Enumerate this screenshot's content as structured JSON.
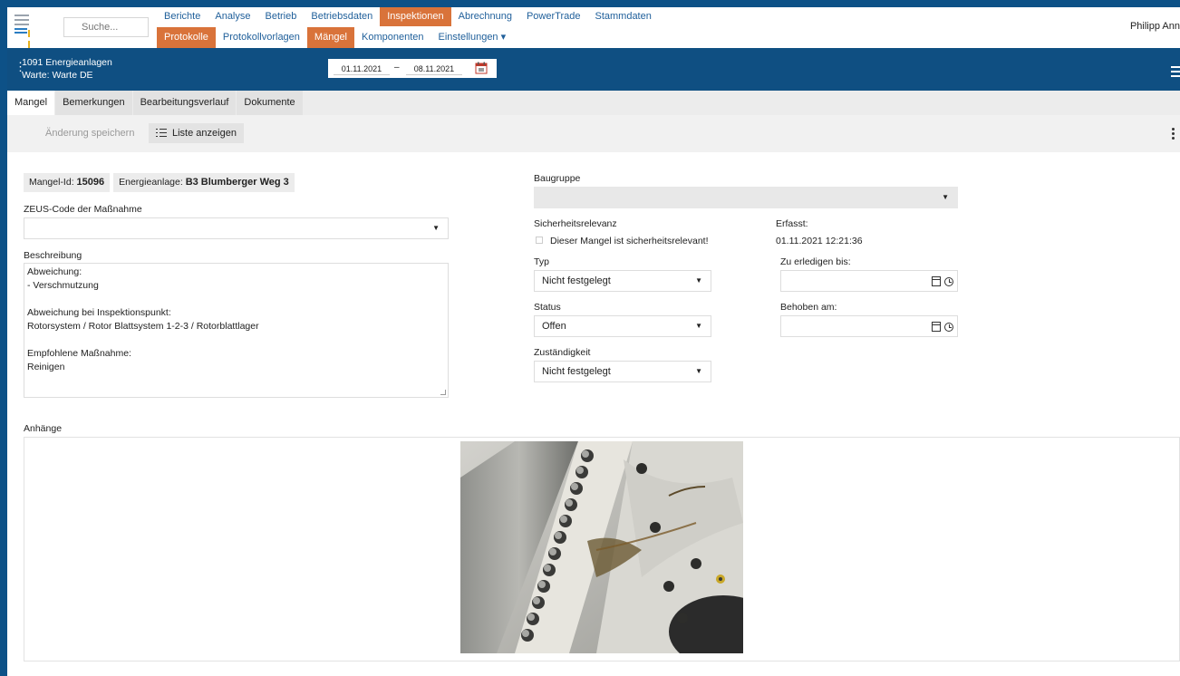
{
  "nav": {
    "search_placeholder": "Suche...",
    "row1": [
      "Berichte",
      "Analyse",
      "Betrieb",
      "Betriebsdaten",
      "Inspektionen",
      "Abrechnung",
      "PowerTrade",
      "Stammdaten"
    ],
    "row1_active": 4,
    "row2": [
      "Protokolle",
      "Protokollvorlagen",
      "Mängel",
      "Komponenten",
      "Einstellungen ▾"
    ],
    "row2_active": [
      0,
      2
    ],
    "user": "Philipp Ann"
  },
  "context": {
    "plant_line1": "1091 Energieanlagen",
    "plant_line2": "Warte: Warte DE",
    "date_from": "01.11.2021",
    "date_separator": "–",
    "date_to": "08.11.2021"
  },
  "tabs": [
    "Mangel",
    "Bemerkungen",
    "Bearbeitungsverlauf",
    "Dokumente"
  ],
  "toolbar": {
    "save_label": "Änderung speichern",
    "list_label": "Liste anzeigen"
  },
  "form": {
    "mangel_id_label": "Mangel-Id:",
    "mangel_id": "15096",
    "anlage_label": "Energieanlage:",
    "anlage": "B3 Blumberger Weg 3",
    "zeus_label": "ZEUS-Code der Maßnahme",
    "zeus_value": "",
    "beschreibung_label": "Beschreibung",
    "beschreibung_lines": [
      "Abweichung:",
      "- Verschmutzung",
      "",
      "Abweichung bei Inspektionspunkt:",
      " Rotorsystem / Rotor Blattsystem 1-2-3 / Rotorblattlager",
      "",
      "Empfohlene Maßnahme:",
      " Reinigen"
    ],
    "baugruppe_label": "Baugruppe",
    "baugruppe_value": "",
    "sicherheit_label": "Sicherheitsrelevanz",
    "sicherheit_checkbox": "Dieser Mangel ist sicherheitsrelevant!",
    "erfasst_label": "Erfasst:",
    "erfasst_value": "01.11.2021 12:21:36",
    "typ_label": "Typ",
    "typ_value": "Nicht festgelegt",
    "zu_erledigen_label": "Zu erledigen bis:",
    "status_label": "Status",
    "status_value": "Offen",
    "behoben_label": "Behoben am:",
    "zustaendigkeit_label": "Zuständigkeit",
    "zustaendigkeit_value": "Nicht festgelegt"
  },
  "attachments_label": "Anhänge",
  "colors": {
    "frame": "#0d5187",
    "bluebar": "#0f4f82",
    "accent": "#d9733a",
    "link": "#1f5f9a"
  }
}
